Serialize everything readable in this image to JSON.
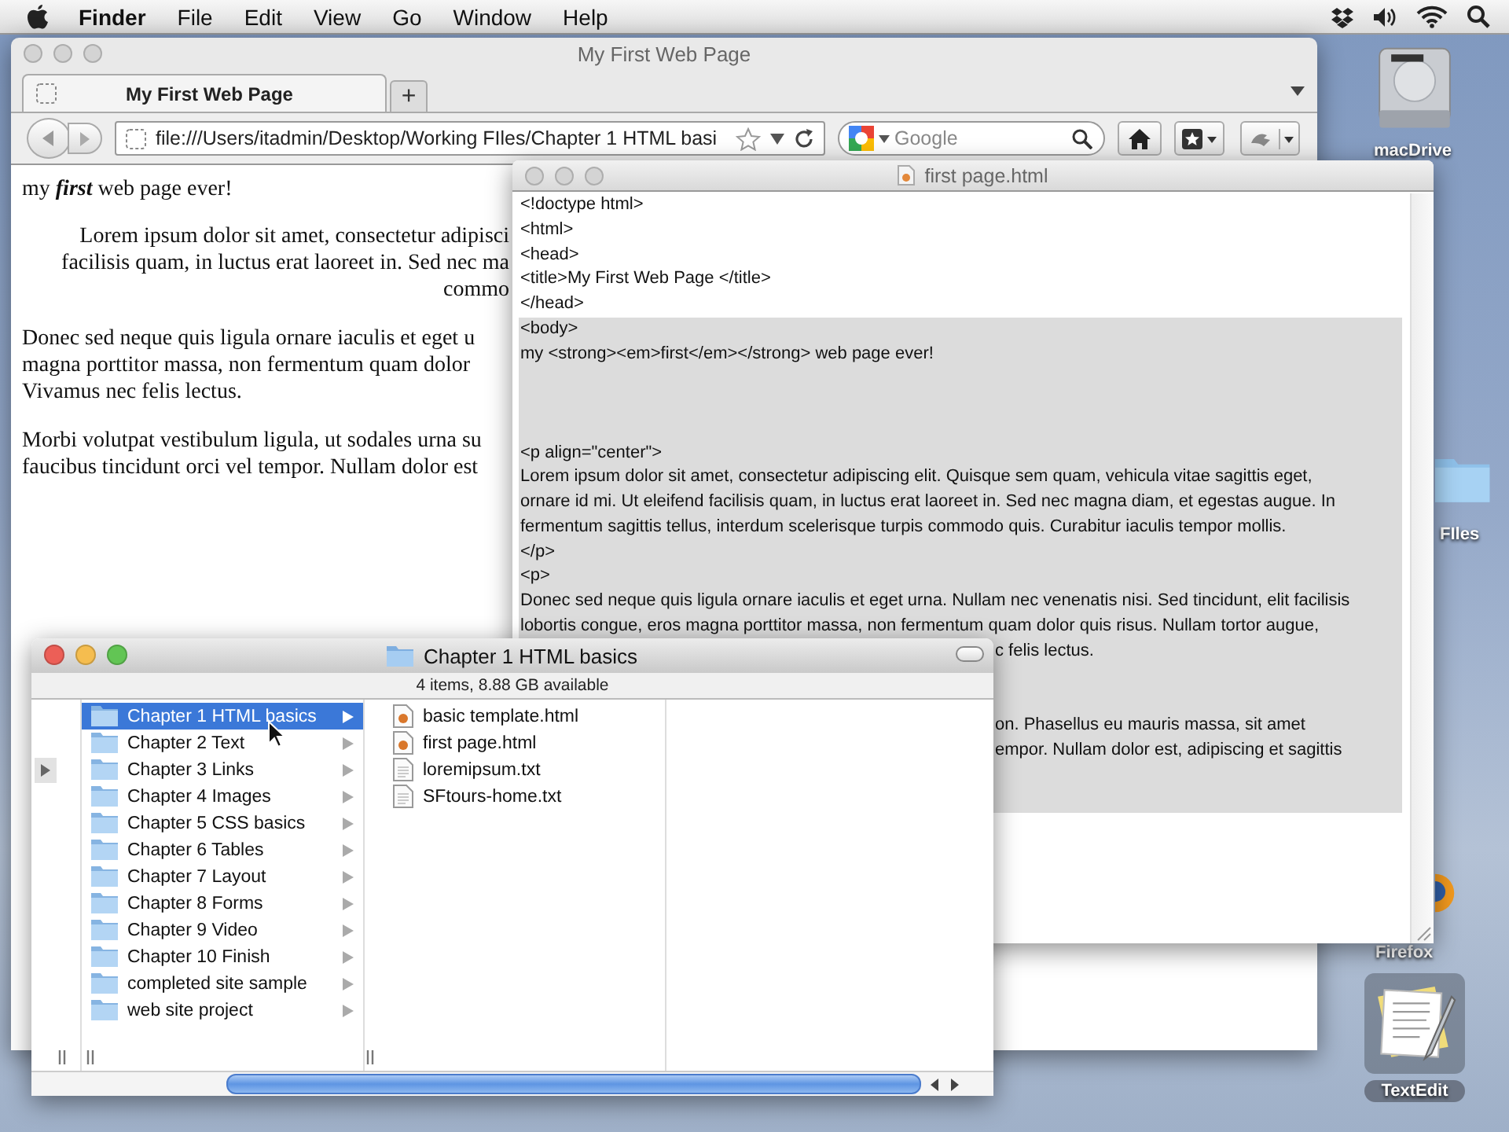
{
  "menubar": {
    "app": "Finder",
    "items": [
      "File",
      "Edit",
      "View",
      "Go",
      "Window",
      "Help"
    ]
  },
  "desktop_icons": [
    {
      "label": "macDrive",
      "kind": "drive"
    },
    {
      "label": "FIles",
      "kind": "folder"
    },
    {
      "label": "Firefox",
      "kind": "app"
    },
    {
      "label": "TextEdit",
      "kind": "textedit"
    }
  ],
  "browser": {
    "title": "My First Web Page",
    "active": false,
    "tabs": [
      {
        "label": "My First Web Page",
        "selected": true
      }
    ],
    "new_tab": "+",
    "url": "file:///Users/itadmin/Desktop/Working FIles/Chapter 1 HTML basi",
    "search": {
      "placeholder": "Google"
    },
    "page": {
      "heading": {
        "before": "my ",
        "emphasis": "first",
        "after": " web page ever!"
      },
      "paragraphs": [
        {
          "kind": "cut",
          "lines": [
            "Lorem ipsum dolor sit amet, consectetur adipisci",
            "facilisis quam, in luctus erat laoreet in. Sed nec ma",
            "commo"
          ]
        },
        {
          "kind": "plain",
          "lines": [
            "Donec sed neque quis ligula ornare iaculis et eget u",
            "magna porttitor massa, non fermentum quam dolor",
            "Vivamus nec felis lectus."
          ]
        },
        {
          "kind": "plain",
          "lines": [
            "Morbi volutpat vestibulum ligula, ut sodales urna su",
            "faucibus tincidunt orci vel tempor. Nullam dolor est"
          ]
        }
      ]
    }
  },
  "editor": {
    "title": "first page.html",
    "active": false,
    "lines": [
      {
        "kind": "code",
        "text": "<!doctype html>",
        "selected": false
      },
      {
        "kind": "code",
        "text": "<html>",
        "selected": false
      },
      {
        "kind": "code",
        "text": "<head>",
        "selected": false
      },
      {
        "kind": "code",
        "text": "<title>My First Web Page </title>",
        "selected": false
      },
      {
        "kind": "code",
        "text": "</head>",
        "selected": false
      },
      {
        "kind": "code",
        "text": "<body>",
        "selected": true
      },
      {
        "kind": "code",
        "text": "my <strong><em>first</em></strong> web page ever!",
        "selected": true
      },
      {
        "kind": "blank",
        "selected": true
      },
      {
        "kind": "blank",
        "selected": true
      },
      {
        "kind": "blank",
        "selected": true
      },
      {
        "kind": "code",
        "text": "<p align=\"center\">",
        "selected": true
      },
      {
        "kind": "code",
        "text": "Lorem ipsum dolor sit amet, consectetur adipiscing elit. Quisque sem quam, vehicula vitae sagittis eget,",
        "selected": true
      },
      {
        "kind": "code",
        "text": "ornare id mi. Ut eleifend facilisis quam, in luctus erat laoreet in. Sed nec magna diam, et egestas augue. In",
        "selected": true
      },
      {
        "kind": "code",
        "text": "fermentum sagittis tellus, interdum scelerisque turpis commodo quis. Curabitur iaculis tempor mollis.",
        "selected": true
      },
      {
        "kind": "code",
        "text": "</p>",
        "selected": true
      },
      {
        "kind": "code",
        "text": "<p>",
        "selected": true
      },
      {
        "kind": "code",
        "text": "Donec sed neque quis ligula ornare iaculis et eget urna. Nullam nec venenatis nisi. Sed tincidunt, elit facilisis",
        "selected": true
      },
      {
        "kind": "code",
        "text": "lobortis congue, eros magna porttitor massa, non fermentum quam dolor quis risus. Nullam tortor augue,",
        "selected": true
      },
      {
        "kind": "tail",
        "text": "c felis lectus.",
        "selected": true
      },
      {
        "kind": "blank",
        "selected": true
      },
      {
        "kind": "blank",
        "selected": true
      },
      {
        "kind": "tail",
        "text": "on. Phasellus eu mauris massa, sit amet",
        "selected": true
      },
      {
        "kind": "tail",
        "text": "empor. Nullam dolor est, adipiscing et sagittis",
        "selected": true
      },
      {
        "kind": "blank",
        "selected": true
      },
      {
        "kind": "blank",
        "selected": true
      }
    ]
  },
  "finder": {
    "title": "Chapter 1 HTML basics",
    "active": true,
    "status": "4 items, 8.88 GB available",
    "folders": [
      {
        "name": "Chapter 1 HTML basics",
        "selected": true
      },
      {
        "name": "Chapter 2 Text",
        "selected": false
      },
      {
        "name": "Chapter 3 Links",
        "selected": false
      },
      {
        "name": "Chapter 4 Images",
        "selected": false
      },
      {
        "name": "Chapter 5 CSS basics",
        "selected": false
      },
      {
        "name": "Chapter 6 Tables",
        "selected": false
      },
      {
        "name": "Chapter 7 Layout",
        "selected": false
      },
      {
        "name": "Chapter 8 Forms",
        "selected": false
      },
      {
        "name": "Chapter 9 Video",
        "selected": false
      },
      {
        "name": "Chapter 10 Finish",
        "selected": false
      },
      {
        "name": "completed site sample",
        "selected": false
      },
      {
        "name": "web site project",
        "selected": false
      }
    ],
    "files": [
      {
        "name": "basic template.html",
        "kind": "html"
      },
      {
        "name": "first page.html",
        "kind": "html"
      },
      {
        "name": "loremipsum.txt",
        "kind": "txt"
      },
      {
        "name": "SFtours-home.txt",
        "kind": "txt"
      }
    ]
  }
}
